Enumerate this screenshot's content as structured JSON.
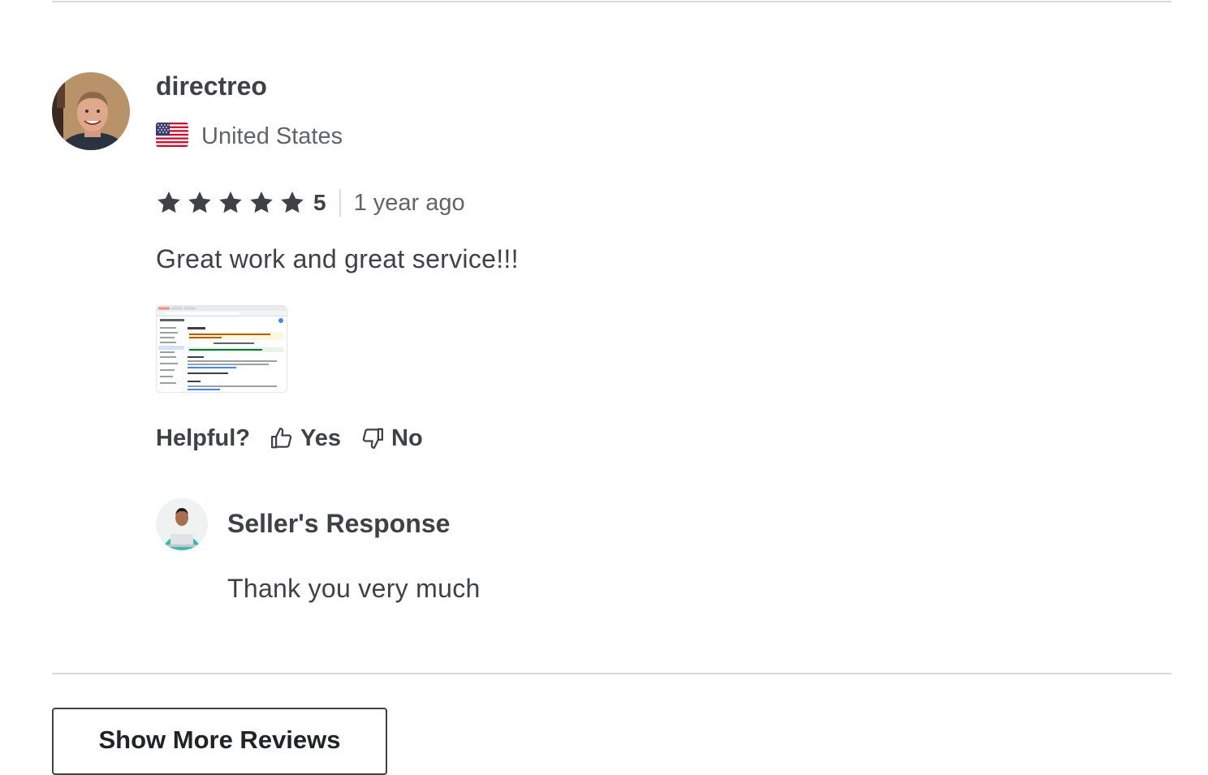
{
  "review": {
    "username": "directreo",
    "country": "United States",
    "flag_icon": "us-flag-icon",
    "rating": {
      "stars": 5,
      "max_stars": 5,
      "value_label": "5",
      "star_color": "#404145"
    },
    "time_ago": "1 year ago",
    "text": "Great work and great service!!!",
    "attachment_icon": "screenshot-thumbnail",
    "helpful": {
      "label": "Helpful?",
      "yes_label": "Yes",
      "no_label": "No"
    },
    "seller_response": {
      "title": "Seller's Response",
      "text": "Thank you very much"
    }
  },
  "show_more_label": "Show More Reviews"
}
